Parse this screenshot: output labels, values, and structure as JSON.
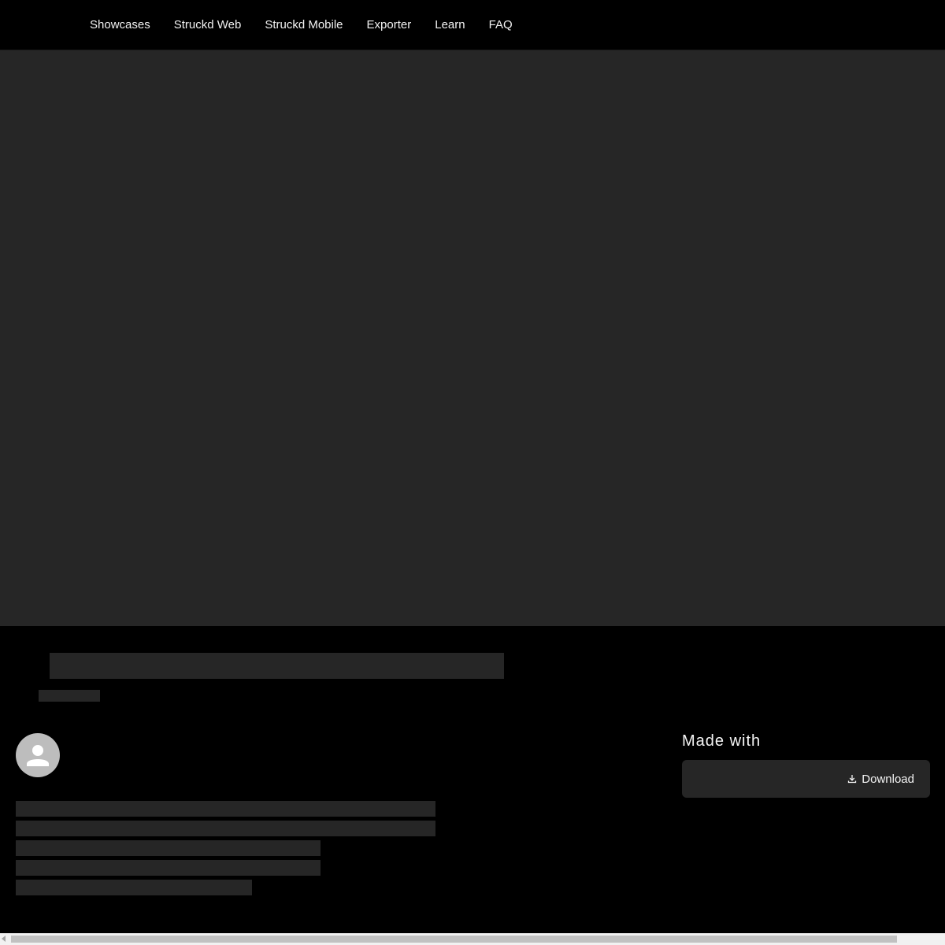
{
  "nav": {
    "items": [
      {
        "label": "Showcases"
      },
      {
        "label": "Struckd Web"
      },
      {
        "label": "Struckd Mobile"
      },
      {
        "label": "Exporter"
      },
      {
        "label": "Learn"
      },
      {
        "label": "FAQ"
      }
    ]
  },
  "sidebar_panel": {
    "made_with_label": "Made with",
    "download_label": "Download",
    "download_icon": "download-icon"
  },
  "avatar": {
    "icon": "person-icon"
  },
  "colors": {
    "background": "#000000",
    "media_placeholder": "#262626",
    "skeleton": "#262626",
    "avatar": "#bdbdbd",
    "text": "#f2f2f2"
  }
}
